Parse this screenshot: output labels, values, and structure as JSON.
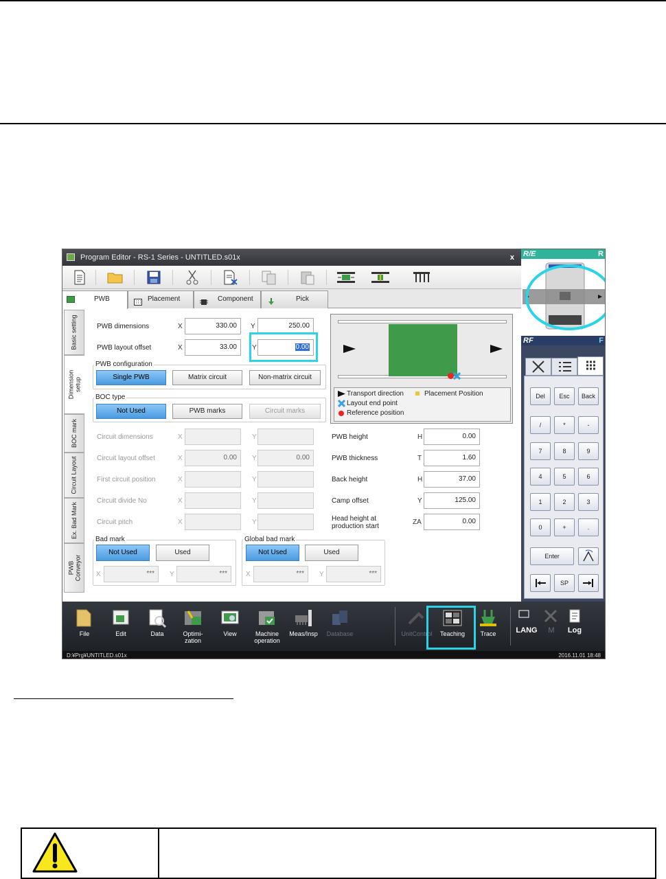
{
  "window": {
    "title": "Program Editor - RS-1 Series - UNTITLED.s01x",
    "close": "x"
  },
  "toolbar": [
    "new-file-icon",
    "open-folder-icon",
    "save-icon",
    "cut-icon",
    "delete-doc-icon",
    "copy-icon",
    "paste-icon",
    "conveyor-in-icon",
    "conveyor-center-icon",
    "feeder-icon"
  ],
  "tabs": [
    {
      "label": "PWB",
      "icon": "green-square"
    },
    {
      "label": "Placement",
      "icon": "grid-icon"
    },
    {
      "label": "Component",
      "icon": "chip-icon"
    },
    {
      "label": "Pick",
      "icon": "nozzle-icon"
    }
  ],
  "side_tabs": [
    "Basic setting",
    "Dimension setup",
    "BOC mark",
    "Circuit Layout",
    "Ex. Bad Mark",
    "PWB Conveyor"
  ],
  "form": {
    "pwb_dimensions": {
      "label": "PWB dimensions",
      "x": "330.00",
      "y": "250.00"
    },
    "pwb_layout_offset": {
      "label": "PWB layout offset",
      "x": "33.00",
      "y": "0.00"
    },
    "pwb_configuration": {
      "title": "PWB configuration",
      "options": [
        "Single PWB",
        "Matrix circuit",
        "Non-matrix circuit"
      ],
      "selected": "Single PWB"
    },
    "boc_type": {
      "title": "BOC type",
      "options": [
        "Not Used",
        "PWB marks",
        "Circuit marks"
      ],
      "selected": "Not Used"
    },
    "circuit_dimensions": {
      "label": "Circuit dimensions",
      "x": "",
      "y": ""
    },
    "circuit_layout_offset": {
      "label": "Circuit layout offset",
      "x": "0.00",
      "y": "0.00"
    },
    "first_circuit_position": {
      "label": "First circuit position",
      "x": "",
      "y": ""
    },
    "circuit_divide_no": {
      "label": "Circuit divide No",
      "x": "",
      "y": ""
    },
    "circuit_pitch": {
      "label": "Circuit pitch",
      "x": "",
      "y": ""
    },
    "bad_mark": {
      "title": "Bad mark",
      "options": [
        "Not Used",
        "Used"
      ],
      "selected": "Not Used",
      "x": "***",
      "y": "***"
    },
    "global_bad_mark": {
      "title": "Global bad mark",
      "options": [
        "Not Used",
        "Used"
      ],
      "selected": "Not Used",
      "x": "***",
      "y": "***"
    },
    "axis_x": "X",
    "axis_y": "Y"
  },
  "right_fields": [
    {
      "label": "PWB height",
      "axis": "H",
      "value": "0.00"
    },
    {
      "label": "PWB thickness",
      "axis": "T",
      "value": "1.60"
    },
    {
      "label": "Back height",
      "axis": "H",
      "value": "37.00"
    },
    {
      "label": "Camp offset",
      "axis": "Y",
      "value": "125.00"
    },
    {
      "label": "Head height at production start",
      "axis": "ZA",
      "value": "0.00"
    }
  ],
  "legend": {
    "transport": "Transport direction",
    "placement": "Placement Position",
    "layout_end": "Layout end point",
    "reference": "Reference position"
  },
  "right_panel": {
    "re": "R/E",
    "r": "R",
    "rf": "RF",
    "f": "F",
    "keys": [
      "Del",
      "Esc",
      "Back",
      "/",
      "*",
      "-",
      "7",
      "8",
      "9",
      "4",
      "5",
      "6",
      "1",
      "2",
      "3",
      "0",
      "+",
      ".",
      "Enter",
      "SP"
    ]
  },
  "bottom": [
    {
      "label": "File"
    },
    {
      "label": "Edit"
    },
    {
      "label": "Data"
    },
    {
      "label": "Optimi-\nzation"
    },
    {
      "label": "View"
    },
    {
      "label": "Machine\noperation"
    },
    {
      "label": "Meas/Insp"
    },
    {
      "label": "Database"
    },
    {
      "label": "UnitControl"
    },
    {
      "label": "Teaching"
    },
    {
      "label": "Trace"
    },
    {
      "label": "LANG"
    },
    {
      "label": "M"
    },
    {
      "label": "Log"
    }
  ],
  "status": {
    "path": "D:¥Prg¥UNTITLED.s01x",
    "datetime": "2016.11.01 18:48"
  },
  "colors": {
    "board": "#3f9a49",
    "highlight": "#2ad4e6",
    "selected_btn": "#4a9be0",
    "panel": "#3c4862"
  }
}
